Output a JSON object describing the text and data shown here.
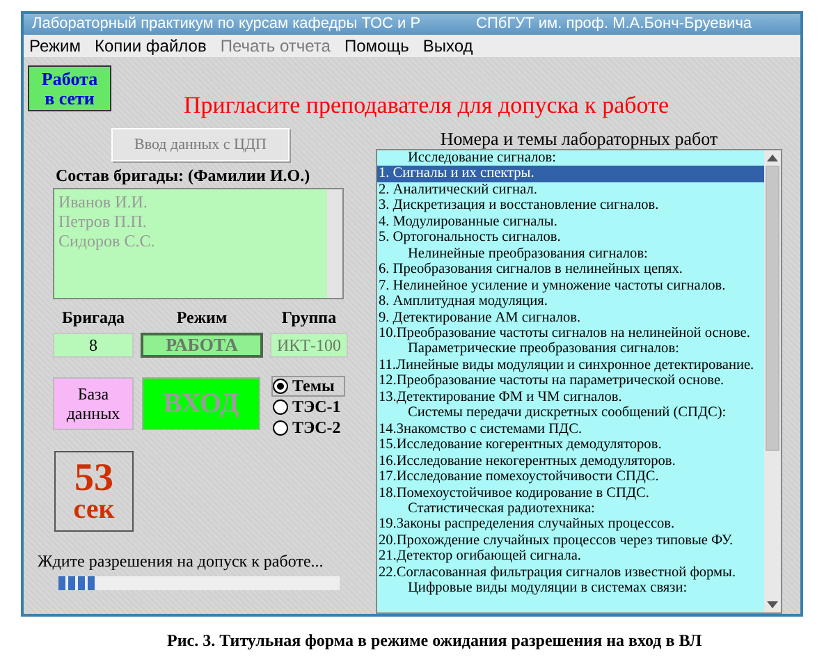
{
  "window": {
    "title": "Лабораторный практикум по курсам кафедры ТОС и Р",
    "subtitle": "СПбГУТ им. проф. М.А.Бонч-Бруевича"
  },
  "menu": [
    {
      "label": "Режим",
      "disabled": false
    },
    {
      "label": "Копии файлов",
      "disabled": false
    },
    {
      "label": "Печать отчета",
      "disabled": true
    },
    {
      "label": "Помощь",
      "disabled": false
    },
    {
      "label": "Выход",
      "disabled": false
    }
  ],
  "network_button": "Работа в сети",
  "invite_message": "Пригласите преподавателя для допуска к работе",
  "ddp_button": {
    "label": "Ввод данных с ЦДП",
    "disabled": true
  },
  "team": {
    "label": "Состав  бригады: (Фамилии И.О.)",
    "members": [
      "Иванов И.И.",
      "Петров П.П.",
      "Сидоров С.С."
    ],
    "disabled": true
  },
  "fields": [
    {
      "label": "Бригада",
      "value": "8",
      "kind": "text",
      "disabled": false
    },
    {
      "label": "Режим",
      "value": "РАБОТА",
      "kind": "status",
      "disabled": true
    },
    {
      "label": "Группа",
      "value": "ИКТ-100",
      "kind": "text",
      "disabled": true
    }
  ],
  "database_button": "База данных",
  "enter_button": {
    "label": "ВХОД",
    "disabled": true
  },
  "modes": [
    {
      "label": "Темы",
      "selected": true
    },
    {
      "label": "ТЭС-1",
      "selected": false
    },
    {
      "label": "ТЭС-2",
      "selected": false
    }
  ],
  "timer": {
    "value": "53",
    "unit": "сек"
  },
  "wait_message": "Ждите разрешения на допуск к работе...",
  "progress": {
    "level": 0.14
  },
  "labs": {
    "title": "Номера и темы лабораторных работ",
    "items": [
      {
        "kind": "header",
        "text": "Исследование сигналов:",
        "selected": false
      },
      {
        "kind": "item",
        "text": "1. Сигналы и их спектры.",
        "selected": true
      },
      {
        "kind": "item",
        "text": "2. Аналитический сигнал.",
        "selected": false
      },
      {
        "kind": "item",
        "text": "3. Дискретизация и восстановление сигналов.",
        "selected": false
      },
      {
        "kind": "item",
        "text": "4. Модулированные сигналы.",
        "selected": false
      },
      {
        "kind": "item",
        "text": "5. Ортогональность сигналов.",
        "selected": false
      },
      {
        "kind": "header",
        "text": "Нелинейные преобразования сигналов:",
        "selected": false
      },
      {
        "kind": "item",
        "text": "6. Преобразования сигналов в нелинейных цепях.",
        "selected": false
      },
      {
        "kind": "item",
        "text": "7. Нелинейное усиление и умножение частоты сигналов.",
        "selected": false
      },
      {
        "kind": "item",
        "text": "8. Амплитудная модуляция.",
        "selected": false
      },
      {
        "kind": "item",
        "text": "9. Детектирование АМ сигналов.",
        "selected": false
      },
      {
        "kind": "item",
        "text": "10.Преобразование частоты сигналов на нелинейной основе.",
        "selected": false
      },
      {
        "kind": "header",
        "text": "Параметрические преобразования сигналов:",
        "selected": false
      },
      {
        "kind": "item",
        "text": "11.Линейные виды модуляции и синхронное детектирование.",
        "selected": false
      },
      {
        "kind": "item",
        "text": "12.Преобразование частоты на параметрической основе.",
        "selected": false
      },
      {
        "kind": "item",
        "text": "13.Детектирование ФМ и ЧМ сигналов.",
        "selected": false
      },
      {
        "kind": "header",
        "text": "Системы передачи дискретных сообщений (СПДС):",
        "selected": false
      },
      {
        "kind": "item",
        "text": "14.Знакомство с системами ПДС.",
        "selected": false
      },
      {
        "kind": "item",
        "text": "15.Исследование когерентных демодуляторов.",
        "selected": false
      },
      {
        "kind": "item",
        "text": "16.Исследование некогерентных демодуляторов.",
        "selected": false
      },
      {
        "kind": "item",
        "text": "17.Исследование помехоустойчивости СПДС.",
        "selected": false
      },
      {
        "kind": "item",
        "text": "18.Помехоустойчивое кодирование в СПДС.",
        "selected": false
      },
      {
        "kind": "header",
        "text": "Статистическая радиотехника:",
        "selected": false
      },
      {
        "kind": "item",
        "text": "19.Законы распределения случайных процессов.",
        "selected": false
      },
      {
        "kind": "item",
        "text": "20.Прохождение случайных процессов через типовые ФУ.",
        "selected": false
      },
      {
        "kind": "item",
        "text": "21.Детектор огибающей сигнала.",
        "selected": false
      },
      {
        "kind": "item",
        "text": "22.Согласованная фильтрация сигналов известной формы.",
        "selected": false
      },
      {
        "kind": "header",
        "text": "Цифровые виды модуляции в системах связи:",
        "selected": false
      }
    ]
  },
  "caption": "Рис. 3. Титульная форма в режиме ожидания разрешения на вход в ВЛ"
}
